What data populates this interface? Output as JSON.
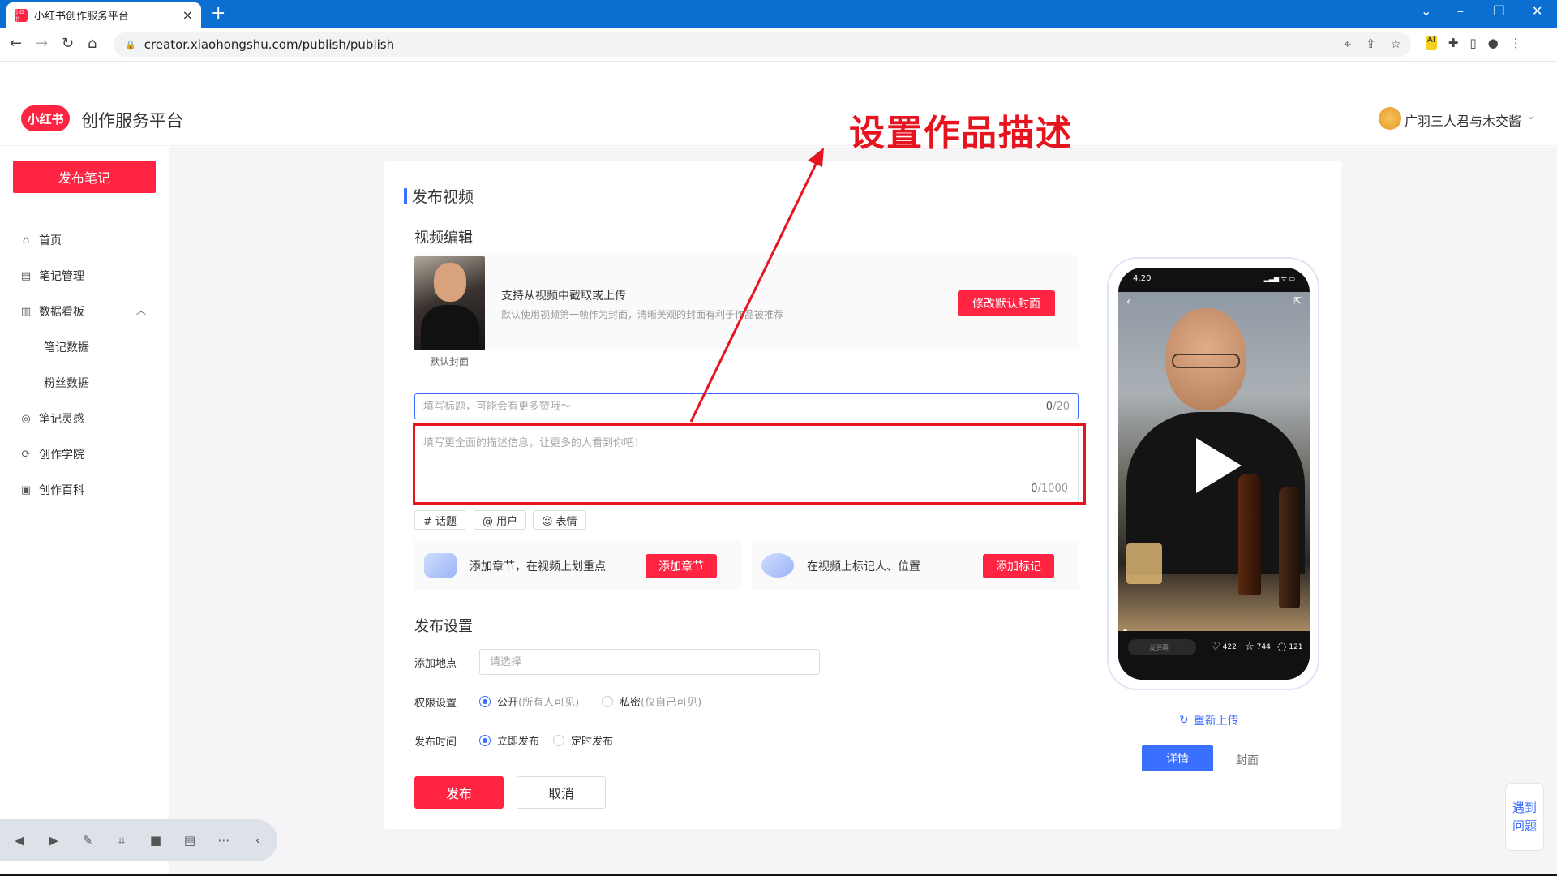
{
  "browser": {
    "tab_title": "小红书创作服务平台",
    "favicon_text": "小红书",
    "url": "creator.xiaohongshu.com/publish/publish"
  },
  "header": {
    "logo_text": "小红书",
    "platform_title": "创作服务平台",
    "user_name": "广羽三人君与木交酱"
  },
  "sidebar": {
    "publish_button": "发布笔记",
    "items": [
      {
        "label": "首页",
        "icon": "home-icon"
      },
      {
        "label": "笔记管理",
        "icon": "notes-icon"
      },
      {
        "label": "数据看板",
        "icon": "chart-icon"
      },
      {
        "label": "笔记数据",
        "sub": true
      },
      {
        "label": "粉丝数据",
        "sub": true
      },
      {
        "label": "笔记灵感",
        "icon": "inspiration-icon"
      },
      {
        "label": "创作学院",
        "icon": "academy-icon"
      },
      {
        "label": "创作百科",
        "icon": "wiki-icon"
      }
    ]
  },
  "main": {
    "section_title": "发布视频",
    "video_edit_title": "视频编辑",
    "cover": {
      "caption": "默认封面",
      "text1": "支持从视频中截取或上传",
      "text2": "默认使用视频第一帧作为封面，清晰美观的封面有利于作品被推荐",
      "button": "修改默认封面"
    },
    "title_input": {
      "placeholder": "填写标题，可能会有更多赞哦～",
      "count": "0",
      "max": "/20"
    },
    "desc_input": {
      "placeholder": "填写更全面的描述信息，让更多的人看到你吧！",
      "count": "0",
      "max": "/1000"
    },
    "tags": [
      "# 话题",
      "@ 用户",
      "☺ 表情"
    ],
    "features": [
      {
        "text": "添加章节，在视频上划重点",
        "button": "添加章节"
      },
      {
        "text": "在视频上标记人、位置",
        "button": "添加标记"
      }
    ],
    "publish_settings": {
      "title": "发布设置",
      "location_label": "添加地点",
      "location_placeholder": "请选择",
      "permission_label": "权限设置",
      "permission_public": "公开",
      "permission_public_hint": "(所有人可见)",
      "permission_private": "私密",
      "permission_private_hint": "(仅自己可见)",
      "time_label": "发布时间",
      "time_now": "立即发布",
      "time_scheduled": "定时发布",
      "permission_selected": "public",
      "time_selected": "now"
    },
    "submit": "发布",
    "cancel": "取消"
  },
  "preview": {
    "time": "4:20",
    "comment_placeholder": "发弹幕",
    "likes": "422",
    "stars": "744",
    "comments": "121",
    "reupload": "重新上传",
    "tab_detail": "详情",
    "tab_cover": "封面"
  },
  "help": {
    "line1": "遇到",
    "line2": "问题"
  },
  "annotation": {
    "label": "设置作品描述",
    "color": "#e5141f"
  },
  "colors": {
    "brand": "#ff2442",
    "accent": "#3b6fff",
    "chrome": "#0a6fd1"
  }
}
